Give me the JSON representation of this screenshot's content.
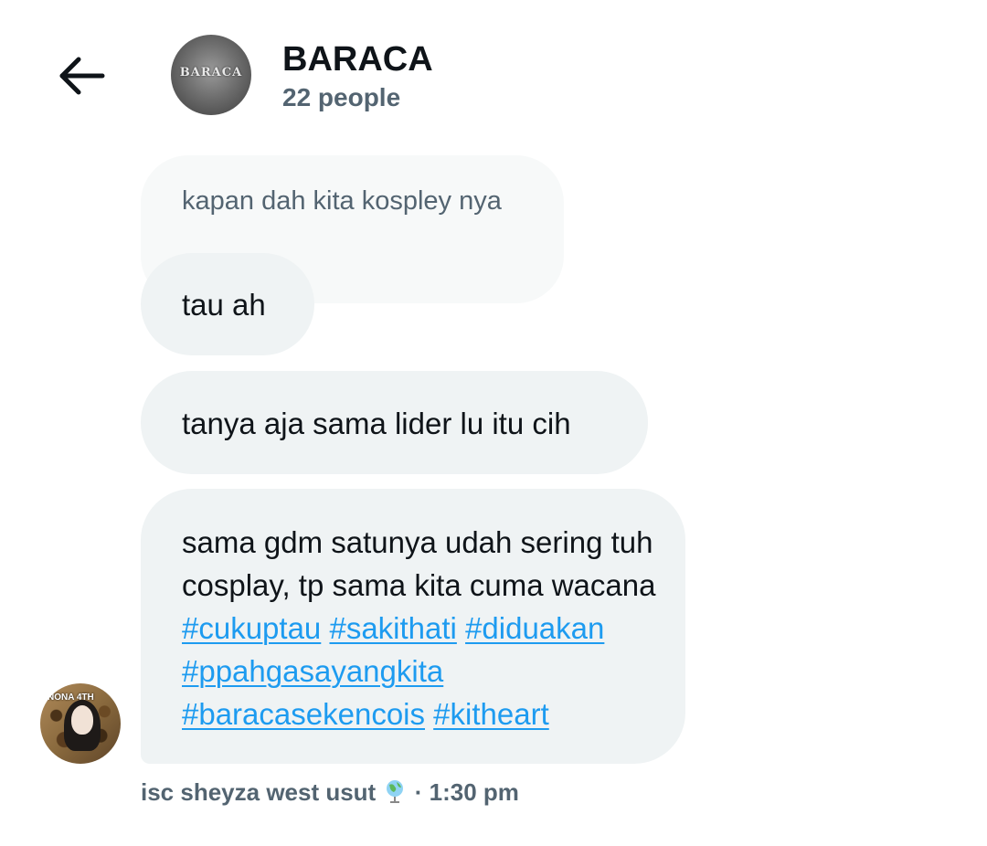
{
  "header": {
    "back_icon": "arrow-left-icon",
    "group_avatar_logo": "BARACA",
    "title": "BARACA",
    "subtitle": "22 people"
  },
  "messages": {
    "quoted": {
      "text": "kapan dah kita kospley nya"
    },
    "msg1": {
      "text": "tau ah"
    },
    "msg2": {
      "text": "tanya aja sama lider lu itu cih"
    },
    "msg3": {
      "text": "sama gdm satunya udah sering tuh cosplay, tp sama kita cuma wacana",
      "hashtags": [
        "#cukuptau",
        "#sakithati",
        "#diduakan",
        "#ppahgasayangkita",
        "#baracasekencois",
        "#kitheart"
      ]
    }
  },
  "sender": {
    "avatar_badge": "NONA 4TH",
    "name": "isc sheyza west usut",
    "name_icon": "globe-icon",
    "separator": "·",
    "time": "1:30 pm"
  },
  "colors": {
    "link": "#1d9bf0",
    "secondary_text": "#536471",
    "bubble_bg": "#eff3f4"
  }
}
